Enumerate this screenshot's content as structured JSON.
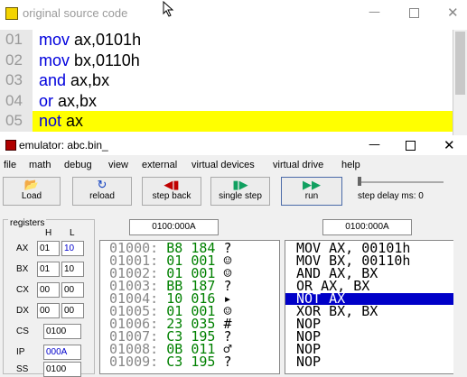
{
  "source_window": {
    "title": "original source code",
    "lines": [
      {
        "num": "01",
        "kw": "mov",
        "args": " ax,0101h"
      },
      {
        "num": "02",
        "kw": "mov",
        "args": " bx,0110h"
      },
      {
        "num": "03",
        "kw": "and",
        "args": " ax,bx"
      },
      {
        "num": "04",
        "kw": "or",
        "args": " ax,bx"
      },
      {
        "num": "05",
        "kw": "not",
        "args": " ax"
      }
    ],
    "highlight_color": "#ffff00"
  },
  "emulator": {
    "title": "emulator: abc.bin_",
    "menu": [
      "file",
      "math",
      "debug",
      "view",
      "external",
      "virtual devices",
      "virtual drive",
      "help"
    ],
    "toolbar": {
      "load": "Load",
      "reload": "reload",
      "step_back": "step back",
      "single_step": "single step",
      "run": "run",
      "step_delay": "step delay ms: 0"
    },
    "registers": {
      "label": "registers",
      "h_header": "H",
      "l_header": "L",
      "rows": [
        {
          "name": "AX",
          "h": "01",
          "l": "10"
        },
        {
          "name": "BX",
          "h": "01",
          "l": "10"
        },
        {
          "name": "CX",
          "h": "00",
          "l": "00"
        },
        {
          "name": "DX",
          "h": "00",
          "l": "00"
        }
      ],
      "seg": [
        {
          "name": "CS",
          "value": "0100"
        },
        {
          "name": "IP",
          "value": "000A"
        },
        {
          "name": "SS",
          "value": "0100"
        }
      ]
    },
    "mem_address": "0100:000A",
    "dis_address": "0100:000A",
    "memory": [
      {
        "addr": "01000:",
        "hex": "B8",
        "dec": "184",
        "ch": "?"
      },
      {
        "addr": "01001:",
        "hex": "01",
        "dec": "001",
        "ch": "☺"
      },
      {
        "addr": "01002:",
        "hex": "01",
        "dec": "001",
        "ch": "☺"
      },
      {
        "addr": "01003:",
        "hex": "BB",
        "dec": "187",
        "ch": "?"
      },
      {
        "addr": "01004:",
        "hex": "10",
        "dec": "016",
        "ch": "▸"
      },
      {
        "addr": "01005:",
        "hex": "01",
        "dec": "001",
        "ch": "☺"
      },
      {
        "addr": "01006:",
        "hex": "23",
        "dec": "035",
        "ch": "#"
      },
      {
        "addr": "01007:",
        "hex": "C3",
        "dec": "195",
        "ch": "?"
      },
      {
        "addr": "01008:",
        "hex": "0B",
        "dec": "011",
        "ch": "♂"
      },
      {
        "addr": "01009:",
        "hex": "C3",
        "dec": "195",
        "ch": "?"
      }
    ],
    "disassembly": [
      "MOV AX, 00101h",
      "MOV BX, 00110h",
      "AND AX, BX",
      "OR AX, BX",
      "NOT AX",
      "XOR BX, BX",
      "NOP",
      "NOP",
      "NOP",
      "NOP"
    ],
    "selected_color": "#0000c8"
  }
}
